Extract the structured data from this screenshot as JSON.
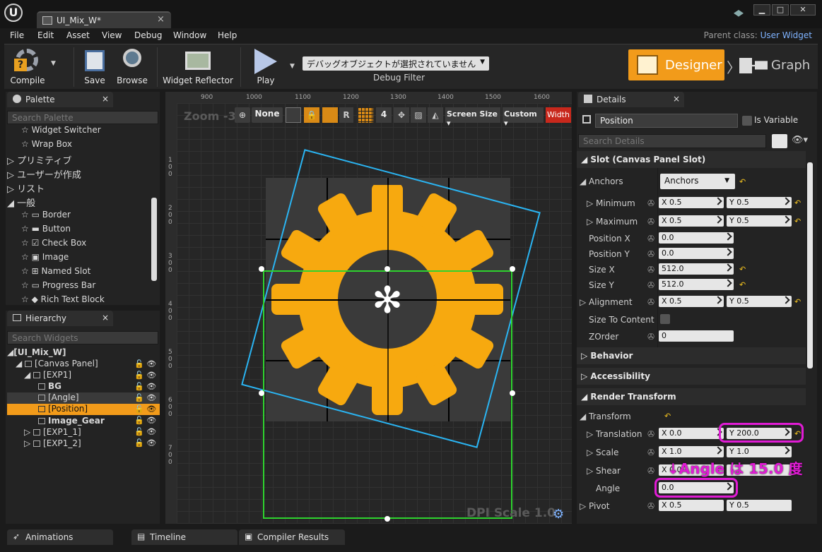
{
  "window": {
    "tab_title": "UI_Mix_W*",
    "minimize": "▁",
    "maximize": "□",
    "close": "✕"
  },
  "menu": [
    "File",
    "Edit",
    "Asset",
    "View",
    "Debug",
    "Window",
    "Help"
  ],
  "parent_class": {
    "label": "Parent class:",
    "value": "User Widget"
  },
  "toolbar": {
    "compile": "Compile",
    "save": "Save",
    "browse": "Browse",
    "widget_reflector": "Widget Reflector",
    "play": "Play",
    "debug_object": "デバッグオブジェクトが選択されていません",
    "debug_filter": "Debug Filter",
    "designer": "Designer",
    "graph": "Graph"
  },
  "palette": {
    "title": "Palette",
    "search_placeholder": "Search Palette",
    "items": [
      "Widget Switcher",
      "Wrap Box",
      "プリミティブ",
      "ユーザーが作成",
      "リスト",
      "一般",
      "Border",
      "Button",
      "Check Box",
      "Image",
      "Named Slot",
      "Progress Bar",
      "Rich Text Block"
    ]
  },
  "hierarchy": {
    "title": "Hierarchy",
    "search_placeholder": "Search Widgets",
    "items": [
      "[UI_Mix_W]",
      "[Canvas Panel]",
      "[EXP1]",
      "BG",
      "[Angle]",
      "[Position]",
      "Image_Gear",
      "[EXP1_1]",
      "[EXP1_2]"
    ]
  },
  "viewport": {
    "zoom": "Zoom -3",
    "none": "None",
    "r": "R",
    "grid_num": "4",
    "screen_size": "Screen Size",
    "custom": "Custom",
    "width": "Width",
    "dpi": "DPI Scale 1.0",
    "ruler_top": [
      "900",
      "1000",
      "1100",
      "1200",
      "1300",
      "1400",
      "1500",
      "1600"
    ],
    "ruler_left": [
      "100",
      "200",
      "300",
      "400",
      "500",
      "600",
      "700"
    ]
  },
  "details": {
    "title": "Details",
    "name": "Position",
    "is_variable": "Is Variable",
    "search_placeholder": "Search Details",
    "slot_header": "Slot (Canvas Panel Slot)",
    "anchors_label": "Anchors",
    "anchors_value": "Anchors",
    "minimum": "Minimum",
    "maximum": "Maximum",
    "min_x": "0.5",
    "min_y": "0.5",
    "max_x": "0.5",
    "max_y": "0.5",
    "position_x": "Position X",
    "position_x_val": "0.0",
    "position_y": "Position Y",
    "position_y_val": "0.0",
    "size_x": "Size X",
    "size_x_val": "512.0",
    "size_y": "Size Y",
    "size_y_val": "512.0",
    "alignment": "Alignment",
    "align_x": "0.5",
    "align_y": "0.5",
    "size_to_content": "Size To Content",
    "zorder": "ZOrder",
    "zorder_val": "0",
    "behavior": "Behavior",
    "accessibility": "Accessibility",
    "render_transform": "Render Transform",
    "transform": "Transform",
    "translation": "Translation",
    "trans_x": "0.0",
    "trans_y": "200.0",
    "scale": "Scale",
    "scale_x": "1.0",
    "scale_y": "1.0",
    "shear": "Shear",
    "shear_x": "0.0",
    "angle": "Angle",
    "angle_val": "0.0",
    "pivot": "Pivot",
    "pivot_x": "0.5",
    "pivot_y": "0.5",
    "annotation": "↓Angle は 15.0 度",
    "x": "X",
    "y": "Y"
  },
  "bottom_tabs": [
    "Animations",
    "Timeline",
    "Compiler Results"
  ]
}
